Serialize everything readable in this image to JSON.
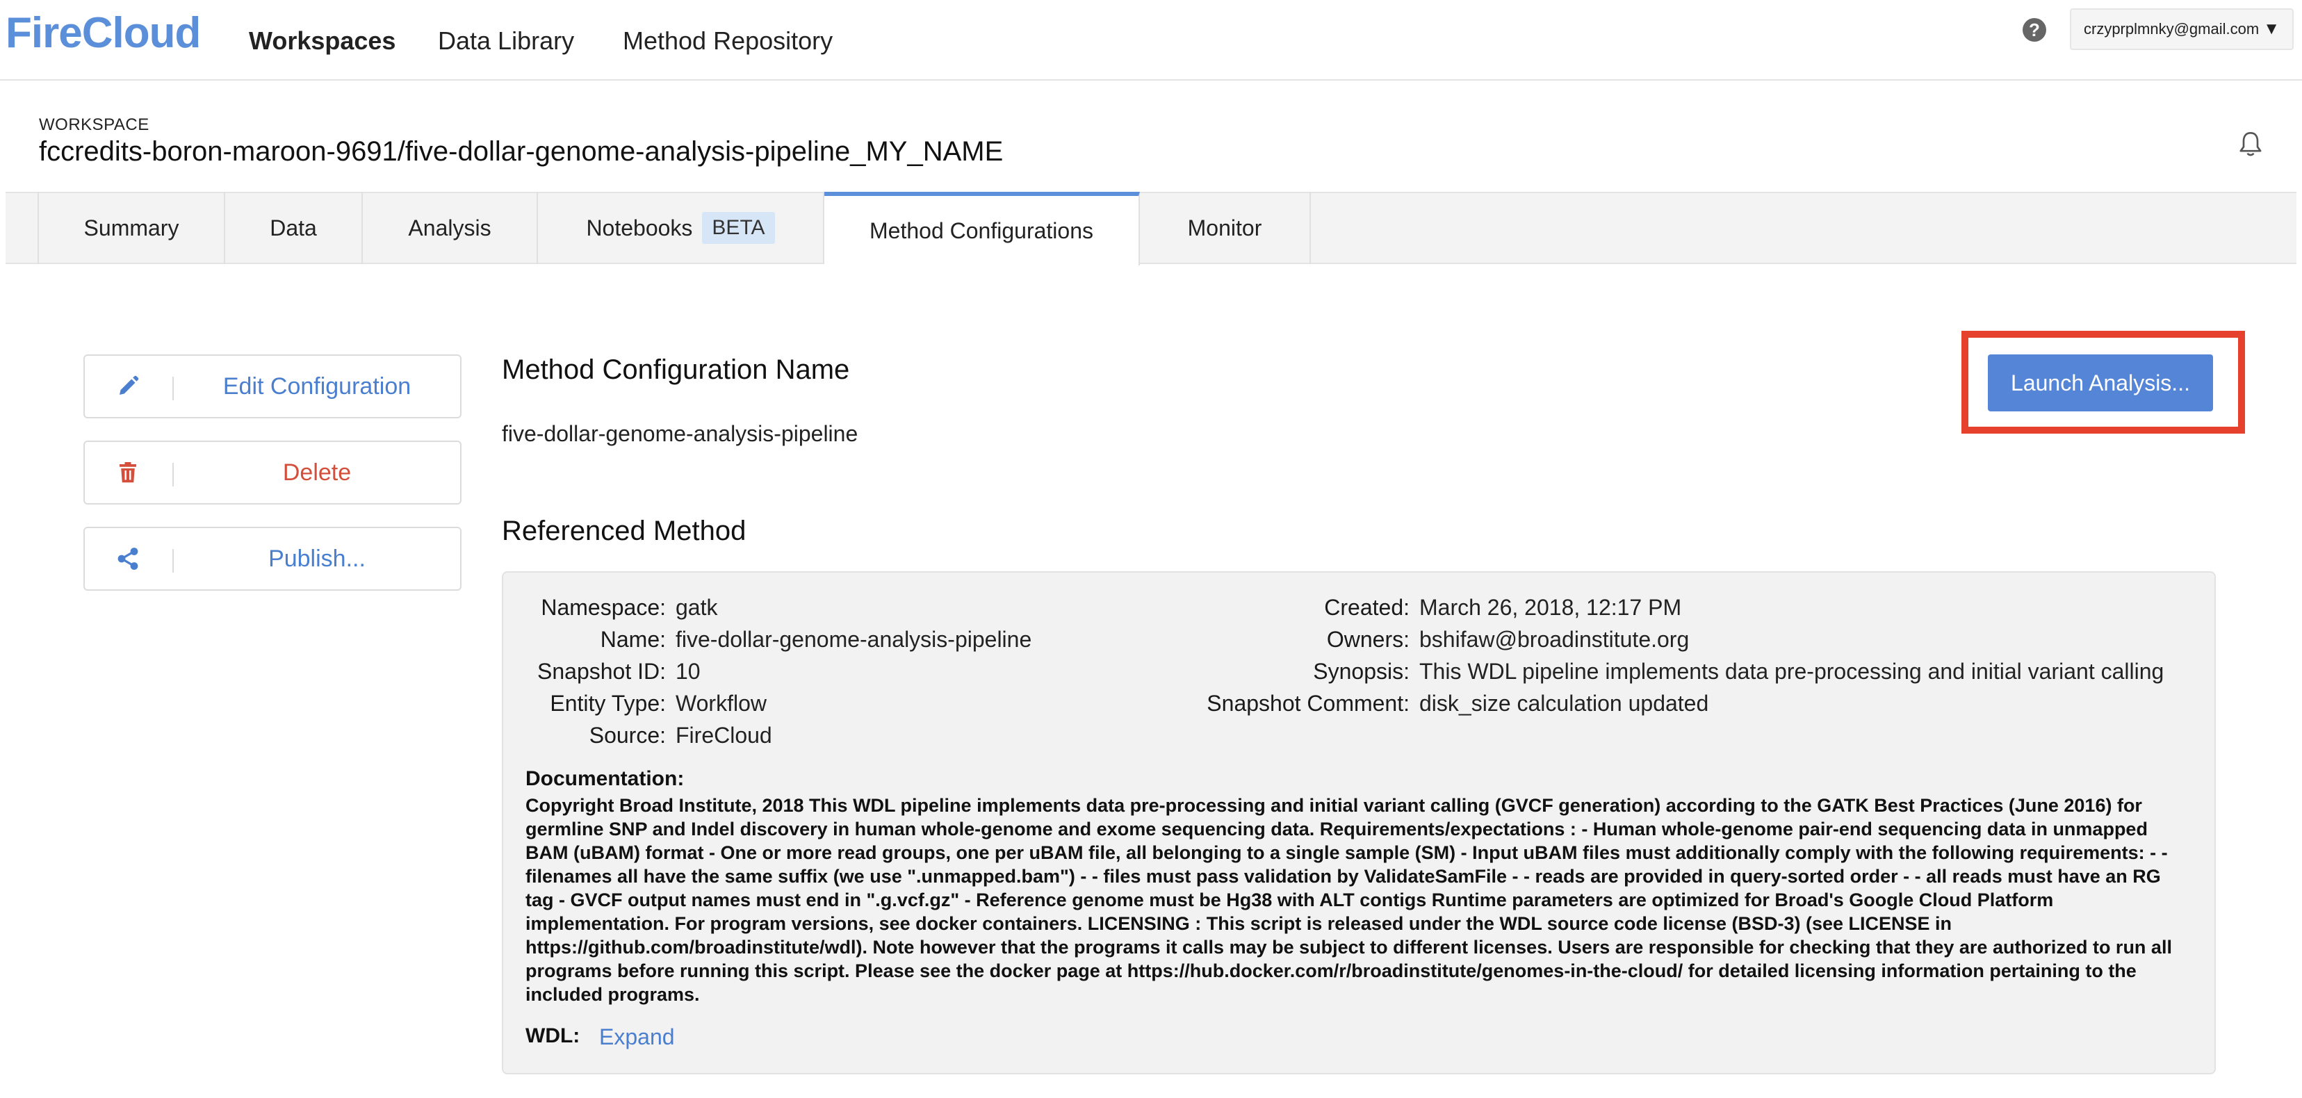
{
  "app": {
    "logo": "FireCloud",
    "nav": [
      "Workspaces",
      "Data Library",
      "Method Repository"
    ],
    "account_email": "crzyprplmnky@gmail.com"
  },
  "workspace": {
    "label": "WORKSPACE",
    "name": "fccredits-boron-maroon-9691/five-dollar-genome-analysis-pipeline_MY_NAME"
  },
  "tabs": {
    "summary": "Summary",
    "data": "Data",
    "analysis": "Analysis",
    "notebooks": "Notebooks",
    "notebooks_badge": "BETA",
    "method_configurations": "Method Configurations",
    "monitor": "Monitor",
    "active": "Method Configurations"
  },
  "actions": {
    "edit": "Edit Configuration",
    "delete": "Delete",
    "publish": "Publish..."
  },
  "main": {
    "config_name_heading": "Method Configuration Name",
    "config_name": "five-dollar-genome-analysis-pipeline",
    "launch_button": "Launch Analysis...",
    "referenced_heading": "Referenced Method"
  },
  "method": {
    "namespace_label": "Namespace:",
    "namespace": "gatk",
    "name_label": "Name:",
    "name": "five-dollar-genome-analysis-pipeline",
    "snapshot_label": "Snapshot ID:",
    "snapshot": "10",
    "entity_label": "Entity Type:",
    "entity": "Workflow",
    "source_label": "Source:",
    "source": "FireCloud",
    "created_label": "Created:",
    "created": "March 26, 2018, 12:17 PM",
    "owners_label": "Owners:",
    "owners": "bshifaw@broadinstitute.org",
    "synopsis_label": "Synopsis:",
    "synopsis": "This WDL pipeline implements data pre-processing and initial variant calling",
    "comment_label": "Snapshot Comment:",
    "comment": "disk_size calculation updated",
    "documentation_label": "Documentation:",
    "documentation": "Copyright Broad Institute, 2018 This WDL pipeline implements data pre-processing and initial variant calling (GVCF generation) according to the GATK Best Practices (June 2016) for germline SNP and Indel discovery in human whole-genome and exome sequencing data. Requirements/expectations : - Human whole-genome pair-end sequencing data in unmapped BAM (uBAM) format - One or more read groups, one per uBAM file, all belonging to a single sample (SM) - Input uBAM files must additionally comply with the following requirements: - - filenames all have the same suffix (we use \".unmapped.bam\") - - files must pass validation by ValidateSamFile - - reads are provided in query-sorted order - - all reads must have an RG tag - GVCF output names must end in \".g.vcf.gz\" - Reference genome must be Hg38 with ALT contigs Runtime parameters are optimized for Broad's Google Cloud Platform implementation. For program versions, see docker containers. LICENSING : This script is released under the WDL source code license (BSD-3) (see LICENSE in https://github.com/broadinstitute/wdl). Note however that the programs it calls may be subject to different licenses. Users are responsible for checking that they are authorized to run all programs before running this script. Please see the docker page at https://hub.docker.com/r/broadinstitute/genomes-in-the-cloud/ for detailed licensing information pertaining to the included programs.",
    "wdl_label": "WDL:",
    "wdl_expand": "Expand"
  },
  "colors": {
    "brand": "#5b8fd9",
    "link": "#4a7fd0",
    "primary_button": "#5585d6",
    "danger": "#d34f3c",
    "highlight_frame": "#e5412c"
  },
  "icons": {
    "help": "question-circle-icon",
    "bell": "bell-icon",
    "edit": "pencil-icon",
    "delete": "trash-icon",
    "publish": "share-icon",
    "account_caret": "caret-down-icon"
  }
}
